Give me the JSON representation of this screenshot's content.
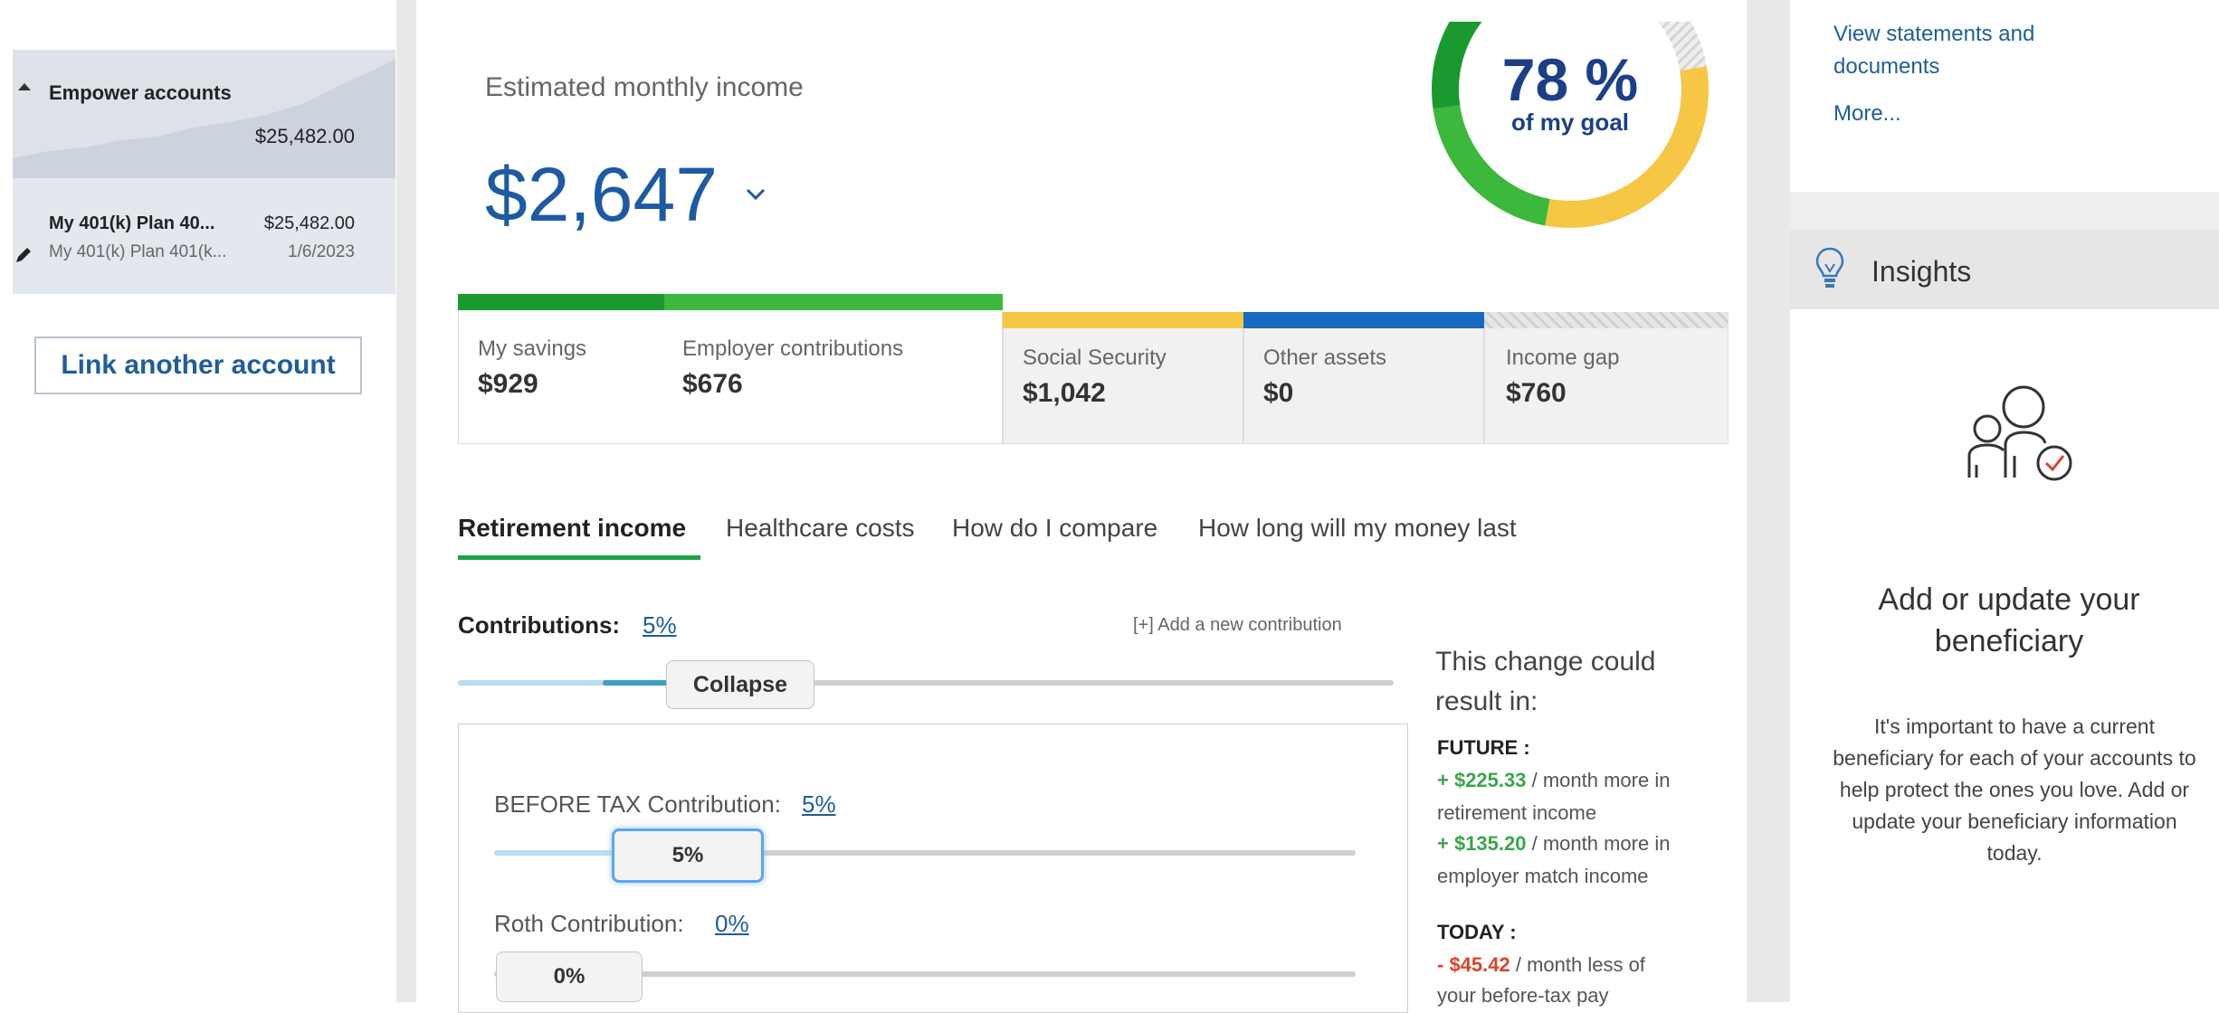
{
  "sidebar": {
    "group_title": "Empower accounts",
    "group_total": "$25,482.00",
    "account": {
      "name": "My 401(k) Plan 40...",
      "amount": "$25,482.00",
      "subtitle": "My 401(k) Plan 401(k...",
      "date": "1/6/2023"
    },
    "link_button": "Link another account"
  },
  "summary": {
    "estimated_label": "Estimated monthly income",
    "amount": "$2,647",
    "goal_percent": "78 %",
    "goal_label": "of my goal",
    "goal_fraction": 0.78
  },
  "breakdown": [
    {
      "label": "My savings",
      "value": "$929",
      "color": "#1a9a2e"
    },
    {
      "label": "Employer contributions",
      "value": "$676",
      "color": "#3cb83c"
    },
    {
      "label": "Social Security",
      "value": "$1,042",
      "color": "#f6c744"
    },
    {
      "label": "Other assets",
      "value": "$0",
      "color": "#1769c2"
    },
    {
      "label": "Income gap",
      "value": "$760",
      "color": "#dcdcdc"
    }
  ],
  "tabs": [
    "Retirement income",
    "Healthcare costs",
    "How do I compare",
    "How long will my money last"
  ],
  "contributions": {
    "label": "Contributions:",
    "percent": "5%",
    "add_link": "[+] Add a new contribution",
    "collapse_label": "Collapse",
    "before_tax_label": "BEFORE TAX Contribution:",
    "before_tax_percent": "5%",
    "before_tax_thumb": "5%",
    "roth_label": "Roth Contribution:",
    "roth_percent": "0%",
    "roth_thumb": "0%"
  },
  "result": {
    "intro": "This change could result in:",
    "future_head": "FUTURE :",
    "future_line1_amount": "+ $225.33",
    "future_line1_text": " / month more in",
    "future_line1_cont": "retirement income",
    "future_line2_amount": "+ $135.20",
    "future_line2_text": " / month more in",
    "future_line2_cont": "employer match income",
    "today_head": "TODAY :",
    "today_amount": "- $45.42",
    "today_text": " / month less of",
    "today_cont": "your before-tax pay"
  },
  "right": {
    "statements_link": "View statements and documents",
    "more_link": "More...",
    "insights_title": "Insights",
    "heading": "Add or update your beneficiary",
    "body": "It's important to have a current beneficiary for each of your accounts to help protect the ones you love. Add or update your beneficiary information today."
  },
  "colors": {
    "accent_blue": "#1e5aa3",
    "link_blue": "#1f5d9c",
    "positive": "#3aa64a",
    "negative": "#d9452b",
    "tab_active": "#1ea34a"
  }
}
